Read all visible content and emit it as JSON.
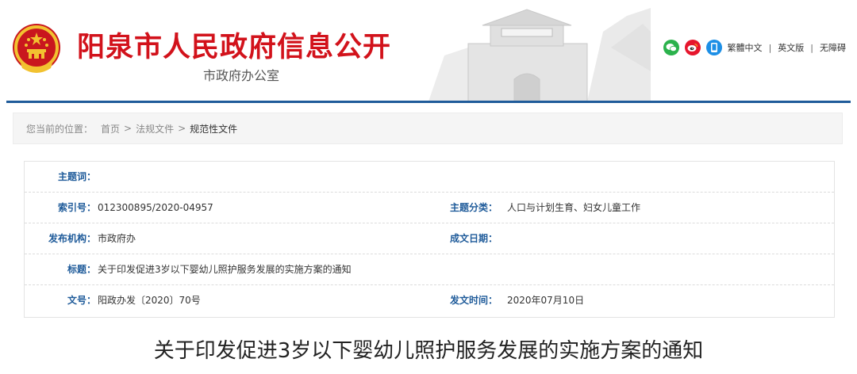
{
  "header": {
    "title": "阳泉市人民政府信息公开",
    "subtitle": "市政府办公室",
    "tools": {
      "icons": [
        "wechat-icon",
        "weibo-icon",
        "mobile-app-icon"
      ],
      "traditional_label": "繁體中文",
      "english_label": "英文版",
      "accessibility_label": "无障碍",
      "separator": "|"
    },
    "colors": {
      "title_red": "#d2121b",
      "rule_blue": "#1f5b9a",
      "wechat_green": "#2bb24c",
      "weibo_red": "#e6162d",
      "app_blue": "#1d8fe6"
    }
  },
  "breadcrumb": {
    "lead": "您当前的位置：",
    "items": [
      "首页",
      "法规文件",
      "规范性文件"
    ],
    "separator": ">"
  },
  "meta": {
    "subject_words": {
      "label": "主题词：",
      "value": ""
    },
    "index_no": {
      "label": "索引号：",
      "value": "012300895/2020-04957"
    },
    "topic_category": {
      "label": "主题分类：",
      "value": "人口与计划生育、妇女儿童工作"
    },
    "issuer": {
      "label": "发布机构：",
      "value": "市政府办"
    },
    "written_date": {
      "label": "成文日期：",
      "value": ""
    },
    "doc_title": {
      "label": "标题：",
      "value": "关于印发促进3岁以下婴幼儿照护服务发展的实施方案的通知"
    },
    "doc_number": {
      "label": "文号：",
      "value": "阳政办发〔2020〕70号"
    },
    "publish_time": {
      "label": "发文时间：",
      "value": "2020年07月10日"
    }
  },
  "document": {
    "title": "关于印发促进3岁以下婴幼儿照护服务发展的实施方案的通知"
  }
}
